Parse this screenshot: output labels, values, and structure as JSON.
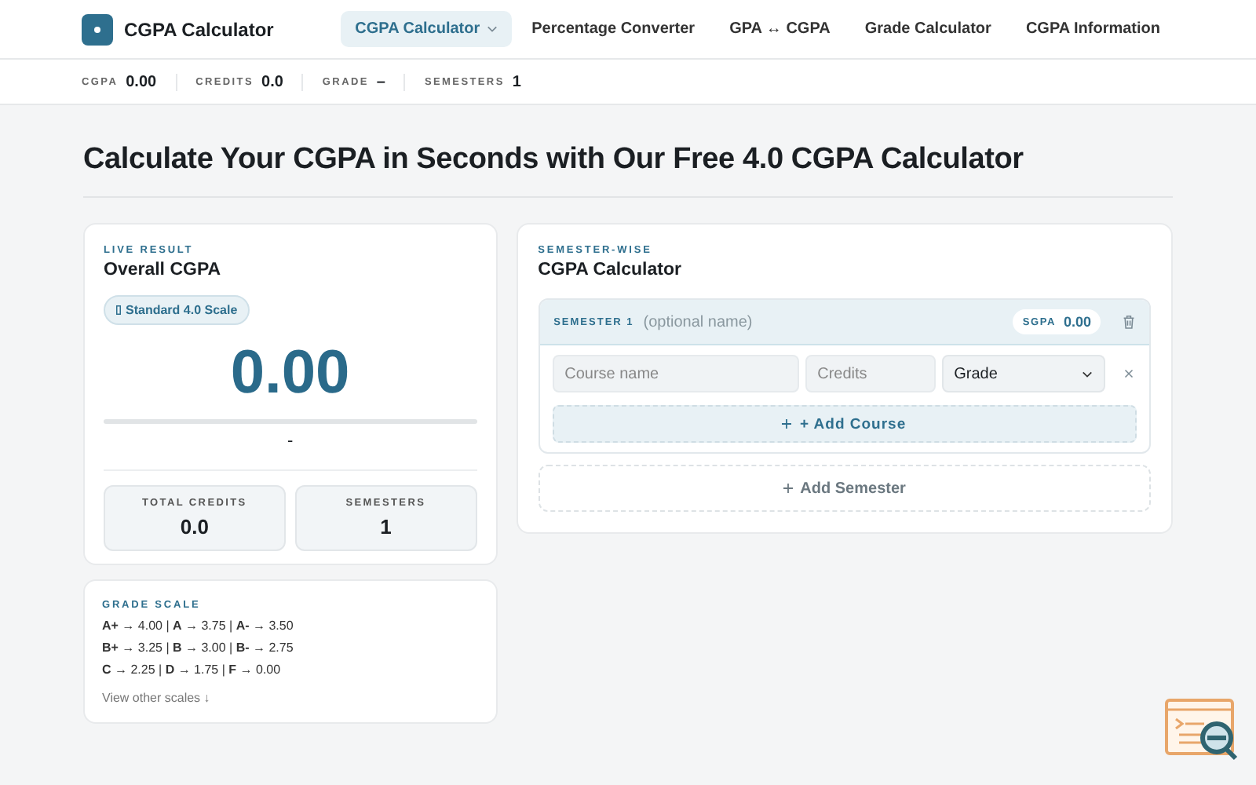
{
  "brand": {
    "name": "CGPA Calculator"
  },
  "nav": [
    {
      "label": "CGPA Calculator",
      "selected": true,
      "dropdown": true
    },
    {
      "label": "Percentage Converter",
      "selected": false,
      "dropdown": false
    },
    {
      "label": "GPA ↔ CGPA",
      "selected": false,
      "dropdown": false
    },
    {
      "label": "Grade Calculator",
      "selected": false,
      "dropdown": false
    },
    {
      "label": "CGPA Information",
      "selected": false,
      "dropdown": false
    }
  ],
  "stats": [
    {
      "label": "CGPA",
      "value": "0.00"
    },
    {
      "label": "CREDITS",
      "value": "0.0"
    },
    {
      "label": "GRADE",
      "value": "–"
    },
    {
      "label": "SEMESTERS",
      "value": "1"
    }
  ],
  "heading": "Calculate Your CGPA in Seconds with Our Free 4.0 CGPA Calculator",
  "result": {
    "eyebrow": "LIVE RESULT",
    "title": "Overall CGPA",
    "scale": "Standard 4.0 Scale",
    "cgpa": "0.00",
    "level": 0,
    "grade": "-",
    "tiles": [
      {
        "label": "TOTAL CREDITS",
        "value": "0.0"
      },
      {
        "label": "SEMESTERS",
        "value": "1"
      }
    ]
  },
  "grade_scale": {
    "title": "GRADE SCALE",
    "lines": [
      "**A+** → 4.00 | **A** → 3.75 | **A-** → 3.50",
      "**B+** → 3.25 | **B** → 3.00 | **B-** → 2.75",
      "**C** → 2.25 | **D** → 1.75 | **F** → 0.00"
    ],
    "link": "View other scales ↓"
  },
  "calculator": {
    "eyebrow": "SEMESTER-WISE",
    "title": "CGPA Calculator",
    "semesters": [
      {
        "label": "SEMESTER 1",
        "name_placeholder": "(optional name)",
        "sgpa_label": "SGPA",
        "sgpa": "0.00",
        "courses": [
          {
            "name_placeholder": "Course name",
            "credits_placeholder": "Credits",
            "grade": "Grade"
          }
        ],
        "add_course": "+ Add Course"
      }
    ],
    "add_semester": "Add Semester"
  }
}
